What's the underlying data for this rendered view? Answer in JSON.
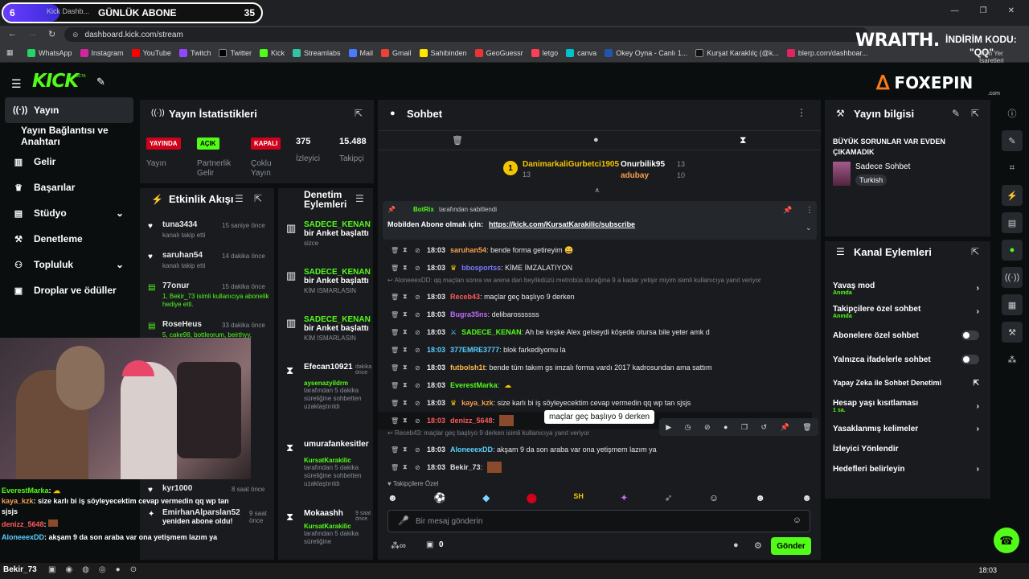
{
  "overlay": {
    "sub_count_badge": "6",
    "sub_label": "GÜNLÜK ABONE",
    "sub_count": "35"
  },
  "browser": {
    "tab_title": "Kick Dashb...",
    "url": "dashboard.kick.com/stream",
    "bookmarks": [
      "WhatsApp",
      "Instagram",
      "YouTube",
      "Twitch",
      "Twitter",
      "Kick",
      "Streamlabs",
      "Mail",
      "Gmail",
      "Sahibinden",
      "GeoGuessr",
      "letgo",
      "canva",
      "Okey Oyna - Canlı 1...",
      "Kurşat Karaklılç (@k...",
      "blerp.com/dashboar..."
    ],
    "bookmarks_right": "Tüm Yer İşaretleri"
  },
  "sponsors": {
    "wraith": "WRAITH.",
    "indirim": "İNDİRİM KODU:",
    "code": "\"QQ\"",
    "foxepin": "FOXEPIN",
    "foxepin_domain": ".com"
  },
  "header": {
    "logo": "KICK",
    "beta": "BETA"
  },
  "nav": {
    "items": [
      "Yayın",
      "Yayın Bağlantısı ve Anahtarı",
      "Gelir",
      "Başarılar",
      "Stüdyo",
      "Denetleme",
      "Topluluk",
      "Droplar ve ödüller"
    ]
  },
  "stats": {
    "title": "Yayın İstatistikleri",
    "items": [
      {
        "badge": "YAYINDA",
        "label": "Yayın"
      },
      {
        "badge": "AÇIK",
        "label": "Partnerlik Gelir Programı"
      },
      {
        "badge": "KAPALI",
        "label": "Çoklu Yayın"
      },
      {
        "value": "375",
        "label": "İzleyici"
      },
      {
        "value": "15.488",
        "label": "Takipçi"
      }
    ]
  },
  "activity": {
    "title": "Etkinlik Akışı",
    "items": [
      {
        "user": "tuna3434",
        "time": "15 saniye önce",
        "text": "kanalı takip etti"
      },
      {
        "user": "saruhan54",
        "time": "14 dakika önce",
        "text": "kanalı takip etti"
      },
      {
        "user": "77onur",
        "time": "15 dakika önce",
        "text": "1, Bekir_73 isimli kullanıcıya abonelik hediye etti."
      },
      {
        "user": "RoseHeus",
        "time": "33 dakika önce",
        "text": "5, cake98, bottleorum, beirthyy,"
      },
      {
        "user": "kyr1000",
        "time": "8 saat önce",
        "text": "kanalı takip etti"
      },
      {
        "user": "EmirhanAlparslan52",
        "time": "9 saat önce",
        "text": "yeniden abone oldu!"
      }
    ]
  },
  "moderation": {
    "title": "Denetim Eylemleri",
    "items": [
      {
        "user": "SADECE_KENAN",
        "action": "bir Anket başlattı",
        "by": "sizce"
      },
      {
        "user": "SADECE_KENAN",
        "action": "bir Anket başlattı",
        "by": "KİM ISMARLASIN"
      },
      {
        "user": "SADECE_KENAN",
        "action": "bir Anket başlattı",
        "by": "KİM ISMARLASIN"
      },
      {
        "user": "Efecan10921",
        "time": "dakika önce",
        "mod": "aysenazyildrm",
        "text": "tarafından 5 dakika süreliğine sohbetten uzaklaştırıldı"
      },
      {
        "user": "umurafankesitler",
        "mod": "KursatKarakilic",
        "text": "tarafından 5 dakika süreliğine sohbetten uzaklaştırıldı"
      },
      {
        "user": "Mokaashh",
        "time": "9 saat önce",
        "mod": "KursatKarakilic",
        "text": "tarafından 5 dakika süreliğine"
      }
    ]
  },
  "chat": {
    "title": "Sohbet",
    "top_gifters": [
      {
        "rank": "1",
        "name": "DanimarkaliGurbetci1905",
        "count": "13"
      },
      {
        "name": "Onurbilik95",
        "count": "13"
      },
      {
        "name": "adubay",
        "count": "10"
      }
    ],
    "pinned": {
      "by": "BotRix",
      "by_suffix": "tarafından sabitlendi",
      "text": "Mobilden Abone olmak için:",
      "link": "https://kick.com/KursatKarakilic/subscribe"
    },
    "messages": [
      {
        "time": "18:03",
        "user": "saruhan54",
        "color": "#f6a04d",
        "text": ": bende forma getireyim 😄"
      },
      {
        "time": "18:03",
        "user": "bbosportss",
        "color": "#7a7cff",
        "text": ": KİME İMZALATIYON"
      },
      {
        "reply": "AloneeexDD: qq maçtan sonra vw arena dan beylikdüzü metrobüs durağına 9 a kadar yetişir miyim isimli kullanıcıya yanıt veriyor"
      },
      {
        "time": "18:03",
        "user": "Receb43",
        "color": "#ff5a5a",
        "text": ": maçlar geç başlıyo 9 derken"
      },
      {
        "time": "18:03",
        "user": "Bugra35ns",
        "color": "#c06bff",
        "text": ": delibarossssss"
      },
      {
        "time": "18:03",
        "user": "SADECE_KENAN",
        "color": "#53fc18",
        "text": ": Ah be keşke Alex gelseydi köşede otursa bile yeter amk d"
      },
      {
        "time": "18:03",
        "user": "377EMRE3777",
        "color": "#5ad1ff",
        "text": ": blok farkediyomu la"
      },
      {
        "time": "18:03",
        "user": "futbolsh1t",
        "color": "#ffb84d",
        "text": ": bende tüm takım gs imzalı forma vardı 2017 kadrosundan ama sattım"
      },
      {
        "time": "18:03",
        "user": "EverestMarka",
        "color": "#53fc18",
        "text": ":"
      },
      {
        "time": "18:03",
        "user": "kaya_kzk",
        "color": "#f6a04d",
        "text": ": size karlı bi iş söyleyecektim cevap vermedin qq wp tan sjsjs"
      },
      {
        "time": "18:03",
        "user": "denizz_5648",
        "color": "#ff5a5a",
        "text": ":"
      },
      {
        "reply": "Receb43: maçlar geç başlıyo 9 derken isimli kullanıcıya yanıt veriyor"
      },
      {
        "time": "18:03",
        "user": "AloneeexDD",
        "color": "#5ad1ff",
        "text": ": akşam 9 da son araba var ona yetişmem lazım ya"
      },
      {
        "time": "18:03",
        "user": "Bekir_73",
        "color": "#ddd",
        "text": ":"
      }
    ],
    "tooltip": "maçlar geç başlıyo 9 derken",
    "emote_section": "Takipçilere Özel",
    "input_placeholder": "Bir mesaj gönderin",
    "points": "0",
    "send": "Gönder"
  },
  "stream_info": {
    "title": "Yayın bilgisi",
    "stream_title": "BÜYÜK SORUNLAR VAR EVDEN ÇIKAMADIK",
    "category": "Sadece Sohbet",
    "language": "Turkish"
  },
  "channel_actions": {
    "title": "Kanal Eylemleri",
    "items": [
      {
        "label": "Yavaş mod",
        "sub": "Anında",
        "kind": "arrow"
      },
      {
        "label": "Takipçilere özel sohbet",
        "sub": "Anında",
        "kind": "arrow"
      },
      {
        "label": "Abonelere özel sohbet",
        "kind": "toggle"
      },
      {
        "label": "Yalnızca ifadelerle sohbet",
        "kind": "toggle"
      },
      {
        "label": "Yapay Zeka ile Sohbet Denetimi",
        "kind": "ext"
      },
      {
        "label": "Hesap yaşı kısıtlaması",
        "sub": "1 sa.",
        "kind": "arrow"
      },
      {
        "label": "Yasaklanmış kelimeler",
        "kind": "arrow"
      },
      {
        "label": "İzleyici Yönlendir",
        "kind": "none"
      },
      {
        "label": "Hedefleri belirleyin",
        "kind": "arrow"
      }
    ]
  },
  "overlay_chat": [
    {
      "user": "EverestMarka",
      "color": "#53fc18",
      "text": ":"
    },
    {
      "user": "kaya_kzk",
      "color": "#f6a04d",
      "text": ": size karlı bi iş söyleyecektim cevap vermedin qq wp tan sjsjs"
    },
    {
      "user": "denizz_5648",
      "color": "#ff5a5a",
      "text": ":"
    },
    {
      "user": "AloneeexDD",
      "color": "#5ad1ff",
      "text": ": akşam 9 da son araba var ona yetişmem lazım ya"
    },
    {
      "user": "Bekir_73",
      "color": "#ddd",
      "text": ""
    }
  ],
  "taskbar": {
    "time": "18:03"
  },
  "colors": {
    "kick_green": "#53fc18",
    "panel": "#191b1f",
    "bg": "#0b0e0f"
  }
}
